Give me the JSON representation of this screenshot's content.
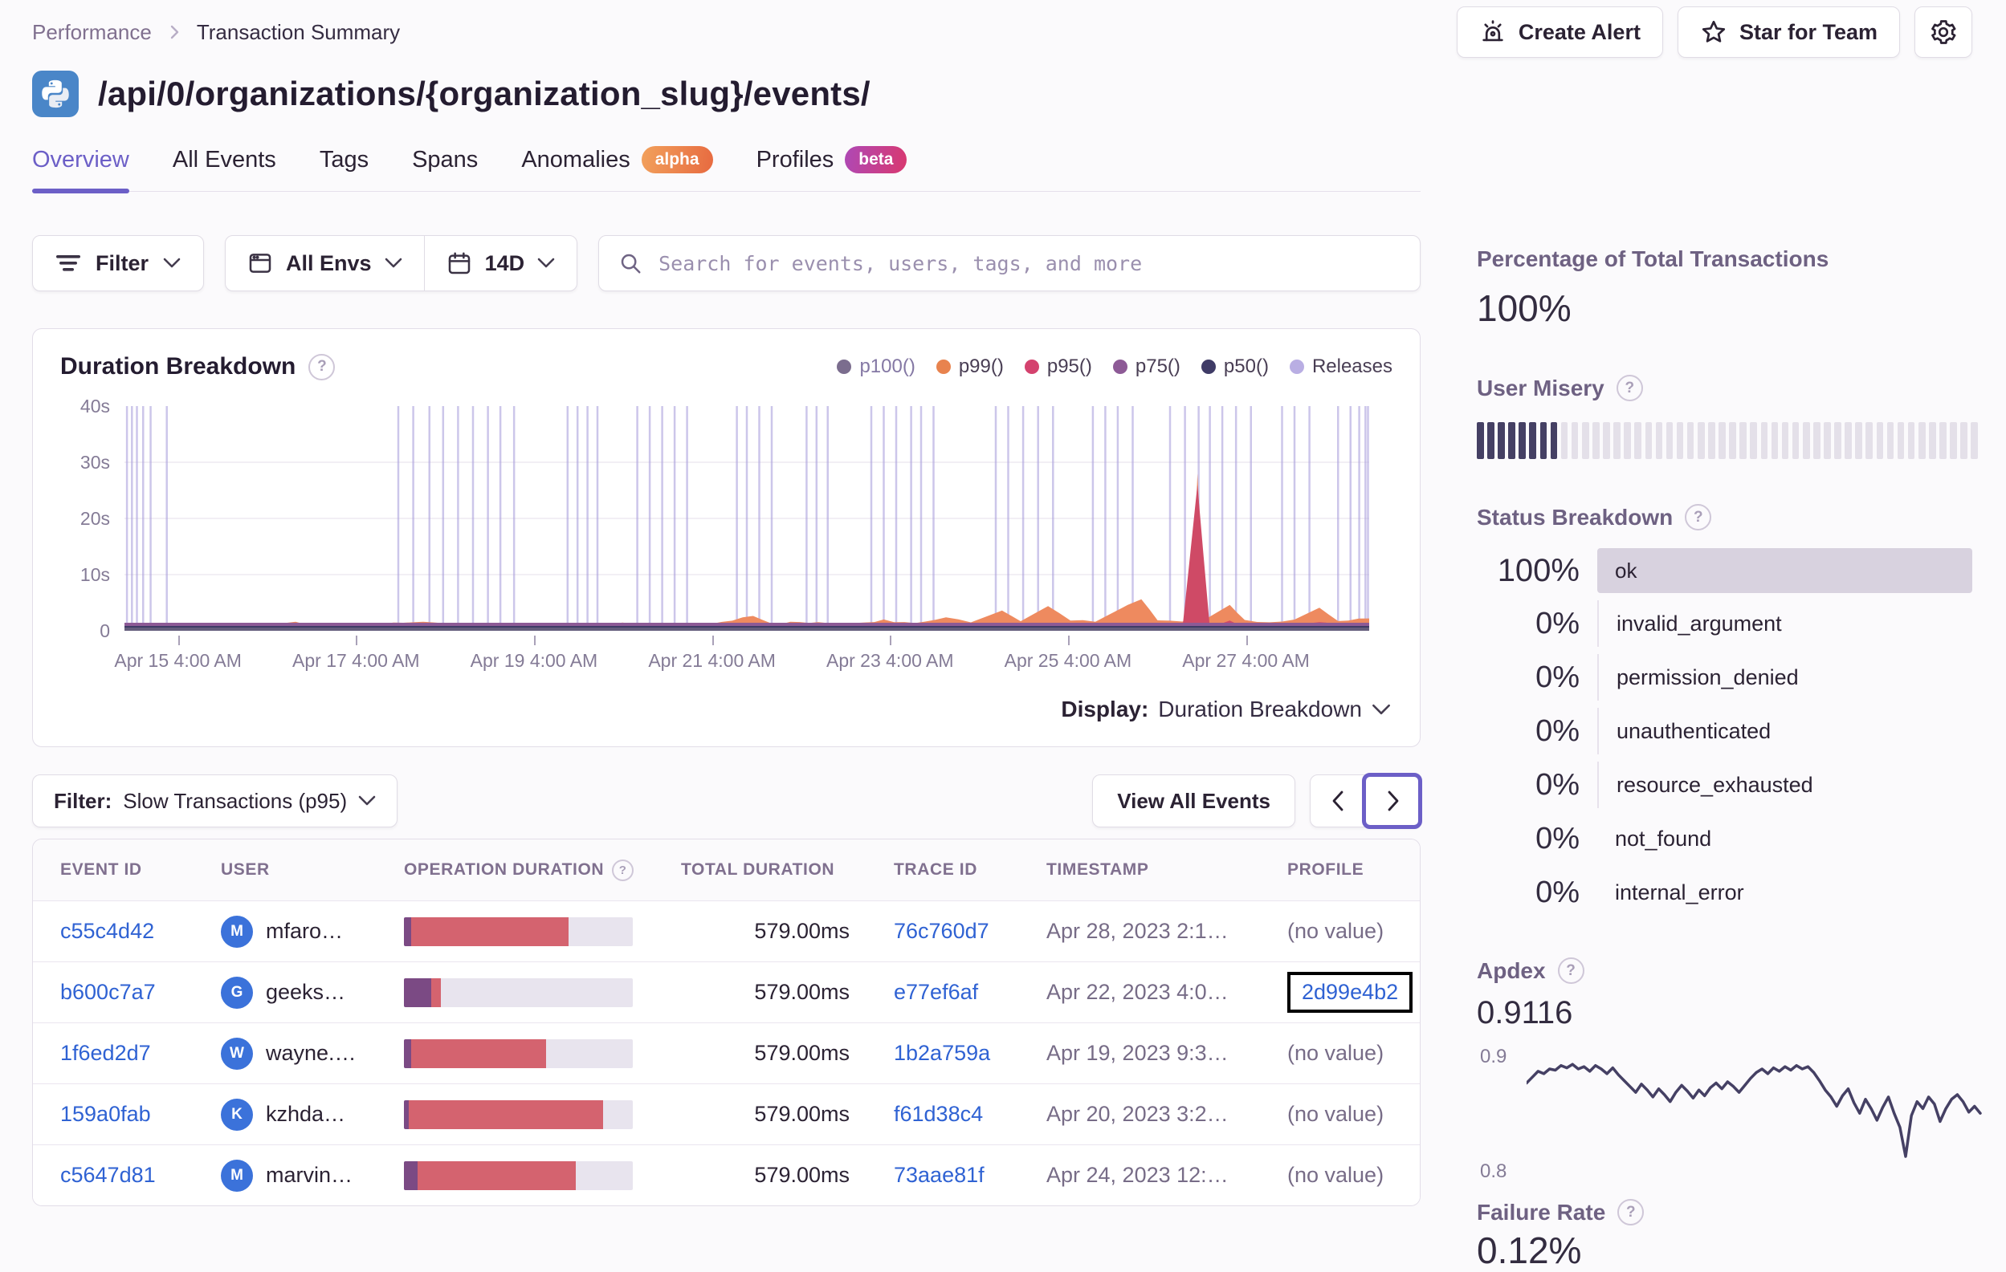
{
  "breadcrumb": {
    "section": "Performance",
    "current": "Transaction Summary"
  },
  "actions": {
    "create_alert": "Create Alert",
    "star_for_team": "Star for Team"
  },
  "header": {
    "title": "/api/0/organizations/{organization_slug}/events/",
    "platform": "python"
  },
  "tabs": [
    {
      "label": "Overview",
      "active": true
    },
    {
      "label": "All Events"
    },
    {
      "label": "Tags"
    },
    {
      "label": "Spans"
    },
    {
      "label": "Anomalies",
      "badge": "alpha"
    },
    {
      "label": "Profiles",
      "badge": "beta"
    }
  ],
  "filters": {
    "filter_label": "Filter",
    "environment": "All Envs",
    "date_range": "14D",
    "search_placeholder": "Search for events, users, tags, and more"
  },
  "duration_chart": {
    "title": "Duration Breakdown",
    "display_label": "Display:",
    "display_value": "Duration Breakdown",
    "legend": [
      {
        "label": "p100()",
        "color": "#7b6d8e",
        "muted": true
      },
      {
        "label": "p99()",
        "color": "#e8834e"
      },
      {
        "label": "p95()",
        "color": "#d4426e"
      },
      {
        "label": "p75()",
        "color": "#8d5a96"
      },
      {
        "label": "p50()",
        "color": "#3f3b66"
      },
      {
        "label": "Releases",
        "color": "#b9aee3"
      }
    ],
    "chart_data": {
      "type": "area",
      "unit": "seconds",
      "ylim": [
        0,
        40
      ],
      "y_ticks": [
        "40s",
        "30s",
        "20s",
        "10s",
        "0"
      ],
      "x_ticks": [
        "Apr 15 4:00 AM",
        "Apr 17 4:00 AM",
        "Apr 19 4:00 AM",
        "Apr 21 4:00 AM",
        "Apr 23 4:00 AM",
        "Apr 25 4:00 AM",
        "Apr 27 4:00 AM"
      ],
      "x_tick_fractions": [
        0.043,
        0.186,
        0.329,
        0.472,
        0.615,
        0.758,
        0.901
      ],
      "p99_profile": [
        [
          0,
          0.9
        ],
        [
          0.03,
          1.2
        ],
        [
          0.06,
          0.8
        ],
        [
          0.1,
          1.0
        ],
        [
          0.13,
          1.5
        ],
        [
          0.16,
          0.9
        ],
        [
          0.2,
          1.1
        ],
        [
          0.24,
          1.6
        ],
        [
          0.27,
          1.0
        ],
        [
          0.31,
          1.2
        ],
        [
          0.35,
          0.9
        ],
        [
          0.4,
          1.3
        ],
        [
          0.44,
          1.0
        ],
        [
          0.48,
          1.4
        ],
        [
          0.505,
          2.8
        ],
        [
          0.52,
          1.2
        ],
        [
          0.55,
          1.6
        ],
        [
          0.58,
          1.2
        ],
        [
          0.61,
          1.9
        ],
        [
          0.635,
          1.3
        ],
        [
          0.66,
          2.4
        ],
        [
          0.68,
          1.5
        ],
        [
          0.705,
          3.6
        ],
        [
          0.72,
          1.7
        ],
        [
          0.742,
          4.4
        ],
        [
          0.76,
          1.9
        ],
        [
          0.78,
          1.6
        ],
        [
          0.806,
          4.6
        ],
        [
          0.817,
          5.6
        ],
        [
          0.83,
          2.0
        ],
        [
          0.85,
          1.7
        ],
        [
          0.858,
          2.2
        ],
        [
          0.862,
          28
        ],
        [
          0.868,
          2.0
        ],
        [
          0.888,
          4.6
        ],
        [
          0.9,
          1.8
        ],
        [
          0.92,
          1.6
        ],
        [
          0.94,
          2.0
        ],
        [
          0.96,
          4.1
        ],
        [
          0.975,
          1.7
        ],
        [
          1,
          2.2
        ]
      ],
      "p95_profile": [
        [
          0,
          0.35
        ],
        [
          0.5,
          0.45
        ],
        [
          0.85,
          0.4
        ],
        [
          0.862,
          26
        ],
        [
          0.872,
          0.45
        ],
        [
          0.888,
          1.8
        ],
        [
          0.9,
          0.4
        ],
        [
          0.96,
          1.5
        ],
        [
          1,
          0.45
        ]
      ],
      "release_positions": [
        0.002,
        0.006,
        0.01,
        0.015,
        0.021,
        0.034,
        0.22,
        0.232,
        0.245,
        0.256,
        0.268,
        0.28,
        0.292,
        0.302,
        0.313,
        0.356,
        0.364,
        0.372,
        0.38,
        0.412,
        0.422,
        0.432,
        0.442,
        0.452,
        0.492,
        0.5,
        0.51,
        0.52,
        0.548,
        0.556,
        0.565,
        0.6,
        0.61,
        0.62,
        0.632,
        0.64,
        0.65,
        0.7,
        0.71,
        0.722,
        0.734,
        0.746,
        0.778,
        0.788,
        0.798,
        0.81,
        0.84,
        0.852,
        0.863,
        0.872,
        0.882,
        0.893,
        0.905,
        0.93,
        0.94,
        0.952,
        0.975,
        0.985,
        0.992,
        0.997,
        1.0
      ],
      "colors": {
        "p99_area": "#ee8a5f",
        "p95_area": "#cf4a66",
        "p75_band": "#8d5a96",
        "p50_band": "#3f3b66",
        "axis_line": "#6b6480",
        "release_line": "#a499d9",
        "gridline": "#f2eff5"
      }
    }
  },
  "events_table": {
    "filter_label": "Filter:",
    "filter_value": "Slow Transactions (p95)",
    "view_all_label": "View All Events",
    "columns": [
      "EVENT ID",
      "USER",
      "OPERATION DURATION",
      "TOTAL DURATION",
      "TRACE ID",
      "TIMESTAMP",
      "PROFILE"
    ],
    "rows": [
      {
        "event_id": "c55c4d42",
        "user": "mfaro…",
        "avatar_letter": "M",
        "op_duration_segments": [
          3,
          69,
          28
        ],
        "total_duration": "579.00ms",
        "trace_id": "76c760d7",
        "timestamp": "Apr 28, 2023 2:1…",
        "profile": "(no value)",
        "profile_link": false,
        "highlighted": false
      },
      {
        "event_id": "b600c7a7",
        "user": "geeks…",
        "avatar_letter": "G",
        "op_duration_segments": [
          12,
          4,
          84
        ],
        "total_duration": "579.00ms",
        "trace_id": "e77ef6af",
        "timestamp": "Apr 22, 2023 4:0…",
        "profile": "2d99e4b2",
        "profile_link": true,
        "highlighted": true
      },
      {
        "event_id": "1f6ed2d7",
        "user": "wayne.…",
        "avatar_letter": "W",
        "op_duration_segments": [
          3,
          59,
          38
        ],
        "total_duration": "579.00ms",
        "trace_id": "1b2a759a",
        "timestamp": "Apr 19, 2023 9:3…",
        "profile": "(no value)",
        "profile_link": false,
        "highlighted": false
      },
      {
        "event_id": "159a0fab",
        "user": "kzhda…",
        "avatar_letter": "K",
        "op_duration_segments": [
          2,
          85,
          13
        ],
        "total_duration": "579.00ms",
        "trace_id": "f61d38c4",
        "timestamp": "Apr 20, 2023 3:2…",
        "profile": "(no value)",
        "profile_link": false,
        "highlighted": false
      },
      {
        "event_id": "c5647d81",
        "user": "marvin…",
        "avatar_letter": "M",
        "op_duration_segments": [
          6,
          69,
          25
        ],
        "total_duration": "579.00ms",
        "trace_id": "73aae81f",
        "timestamp": "Apr 24, 2023 12:…",
        "profile": "(no value)",
        "profile_link": false,
        "highlighted": false
      }
    ],
    "bar_colors": {
      "p75_segment": "#7b4a84",
      "p95_segment": "#d4636f",
      "track": "#e8e4ee"
    }
  },
  "sidebar": {
    "total_transactions": {
      "heading": "Percentage of Total Transactions",
      "value": "100%"
    },
    "user_misery": {
      "heading": "User Misery",
      "total_ticks": 48,
      "filled_ticks": 8
    },
    "status_breakdown": {
      "heading": "Status Breakdown",
      "rows": [
        {
          "pct": "100%",
          "label": "ok",
          "bar": true,
          "lined": false
        },
        {
          "pct": "0%",
          "label": "invalid_argument",
          "bar": false,
          "lined": true
        },
        {
          "pct": "0%",
          "label": "permission_denied",
          "bar": false,
          "lined": true
        },
        {
          "pct": "0%",
          "label": "unauthenticated",
          "bar": false,
          "lined": true
        },
        {
          "pct": "0%",
          "label": "resource_exhausted",
          "bar": false,
          "lined": true
        },
        {
          "pct": "0%",
          "label": "not_found",
          "bar": false,
          "lined": false
        },
        {
          "pct": "0%",
          "label": "internal_error",
          "bar": false,
          "lined": false
        }
      ]
    },
    "apdex": {
      "heading": "Apdex",
      "value": "0.9116",
      "chart_data": {
        "type": "line",
        "ylim": [
          0.795,
          0.91
        ],
        "y_labels": [
          "0.9",
          "0.8"
        ],
        "line_color": "#454064",
        "values": [
          0.878,
          0.883,
          0.888,
          0.886,
          0.89,
          0.889,
          0.893,
          0.891,
          0.894,
          0.89,
          0.892,
          0.888,
          0.893,
          0.89,
          0.886,
          0.891,
          0.885,
          0.88,
          0.875,
          0.87,
          0.877,
          0.872,
          0.866,
          0.873,
          0.868,
          0.862,
          0.87,
          0.876,
          0.871,
          0.865,
          0.872,
          0.867,
          0.874,
          0.878,
          0.873,
          0.879,
          0.875,
          0.87,
          0.876,
          0.882,
          0.887,
          0.89,
          0.886,
          0.891,
          0.888,
          0.892,
          0.889,
          0.893,
          0.89,
          0.892,
          0.887,
          0.88,
          0.872,
          0.866,
          0.858,
          0.867,
          0.873,
          0.861,
          0.852,
          0.864,
          0.856,
          0.846,
          0.857,
          0.866,
          0.852,
          0.84,
          0.815,
          0.85,
          0.862,
          0.856,
          0.866,
          0.86,
          0.845,
          0.856,
          0.864,
          0.868,
          0.862,
          0.853,
          0.858,
          0.852
        ]
      }
    },
    "failure_rate": {
      "heading": "Failure Rate",
      "value": "0.12%"
    }
  },
  "colors": {
    "accent": "#6c5fc7",
    "link": "#2f62d3",
    "text": "#2b2233",
    "secondary_text": "#80708f",
    "border": "#e0dce5"
  }
}
